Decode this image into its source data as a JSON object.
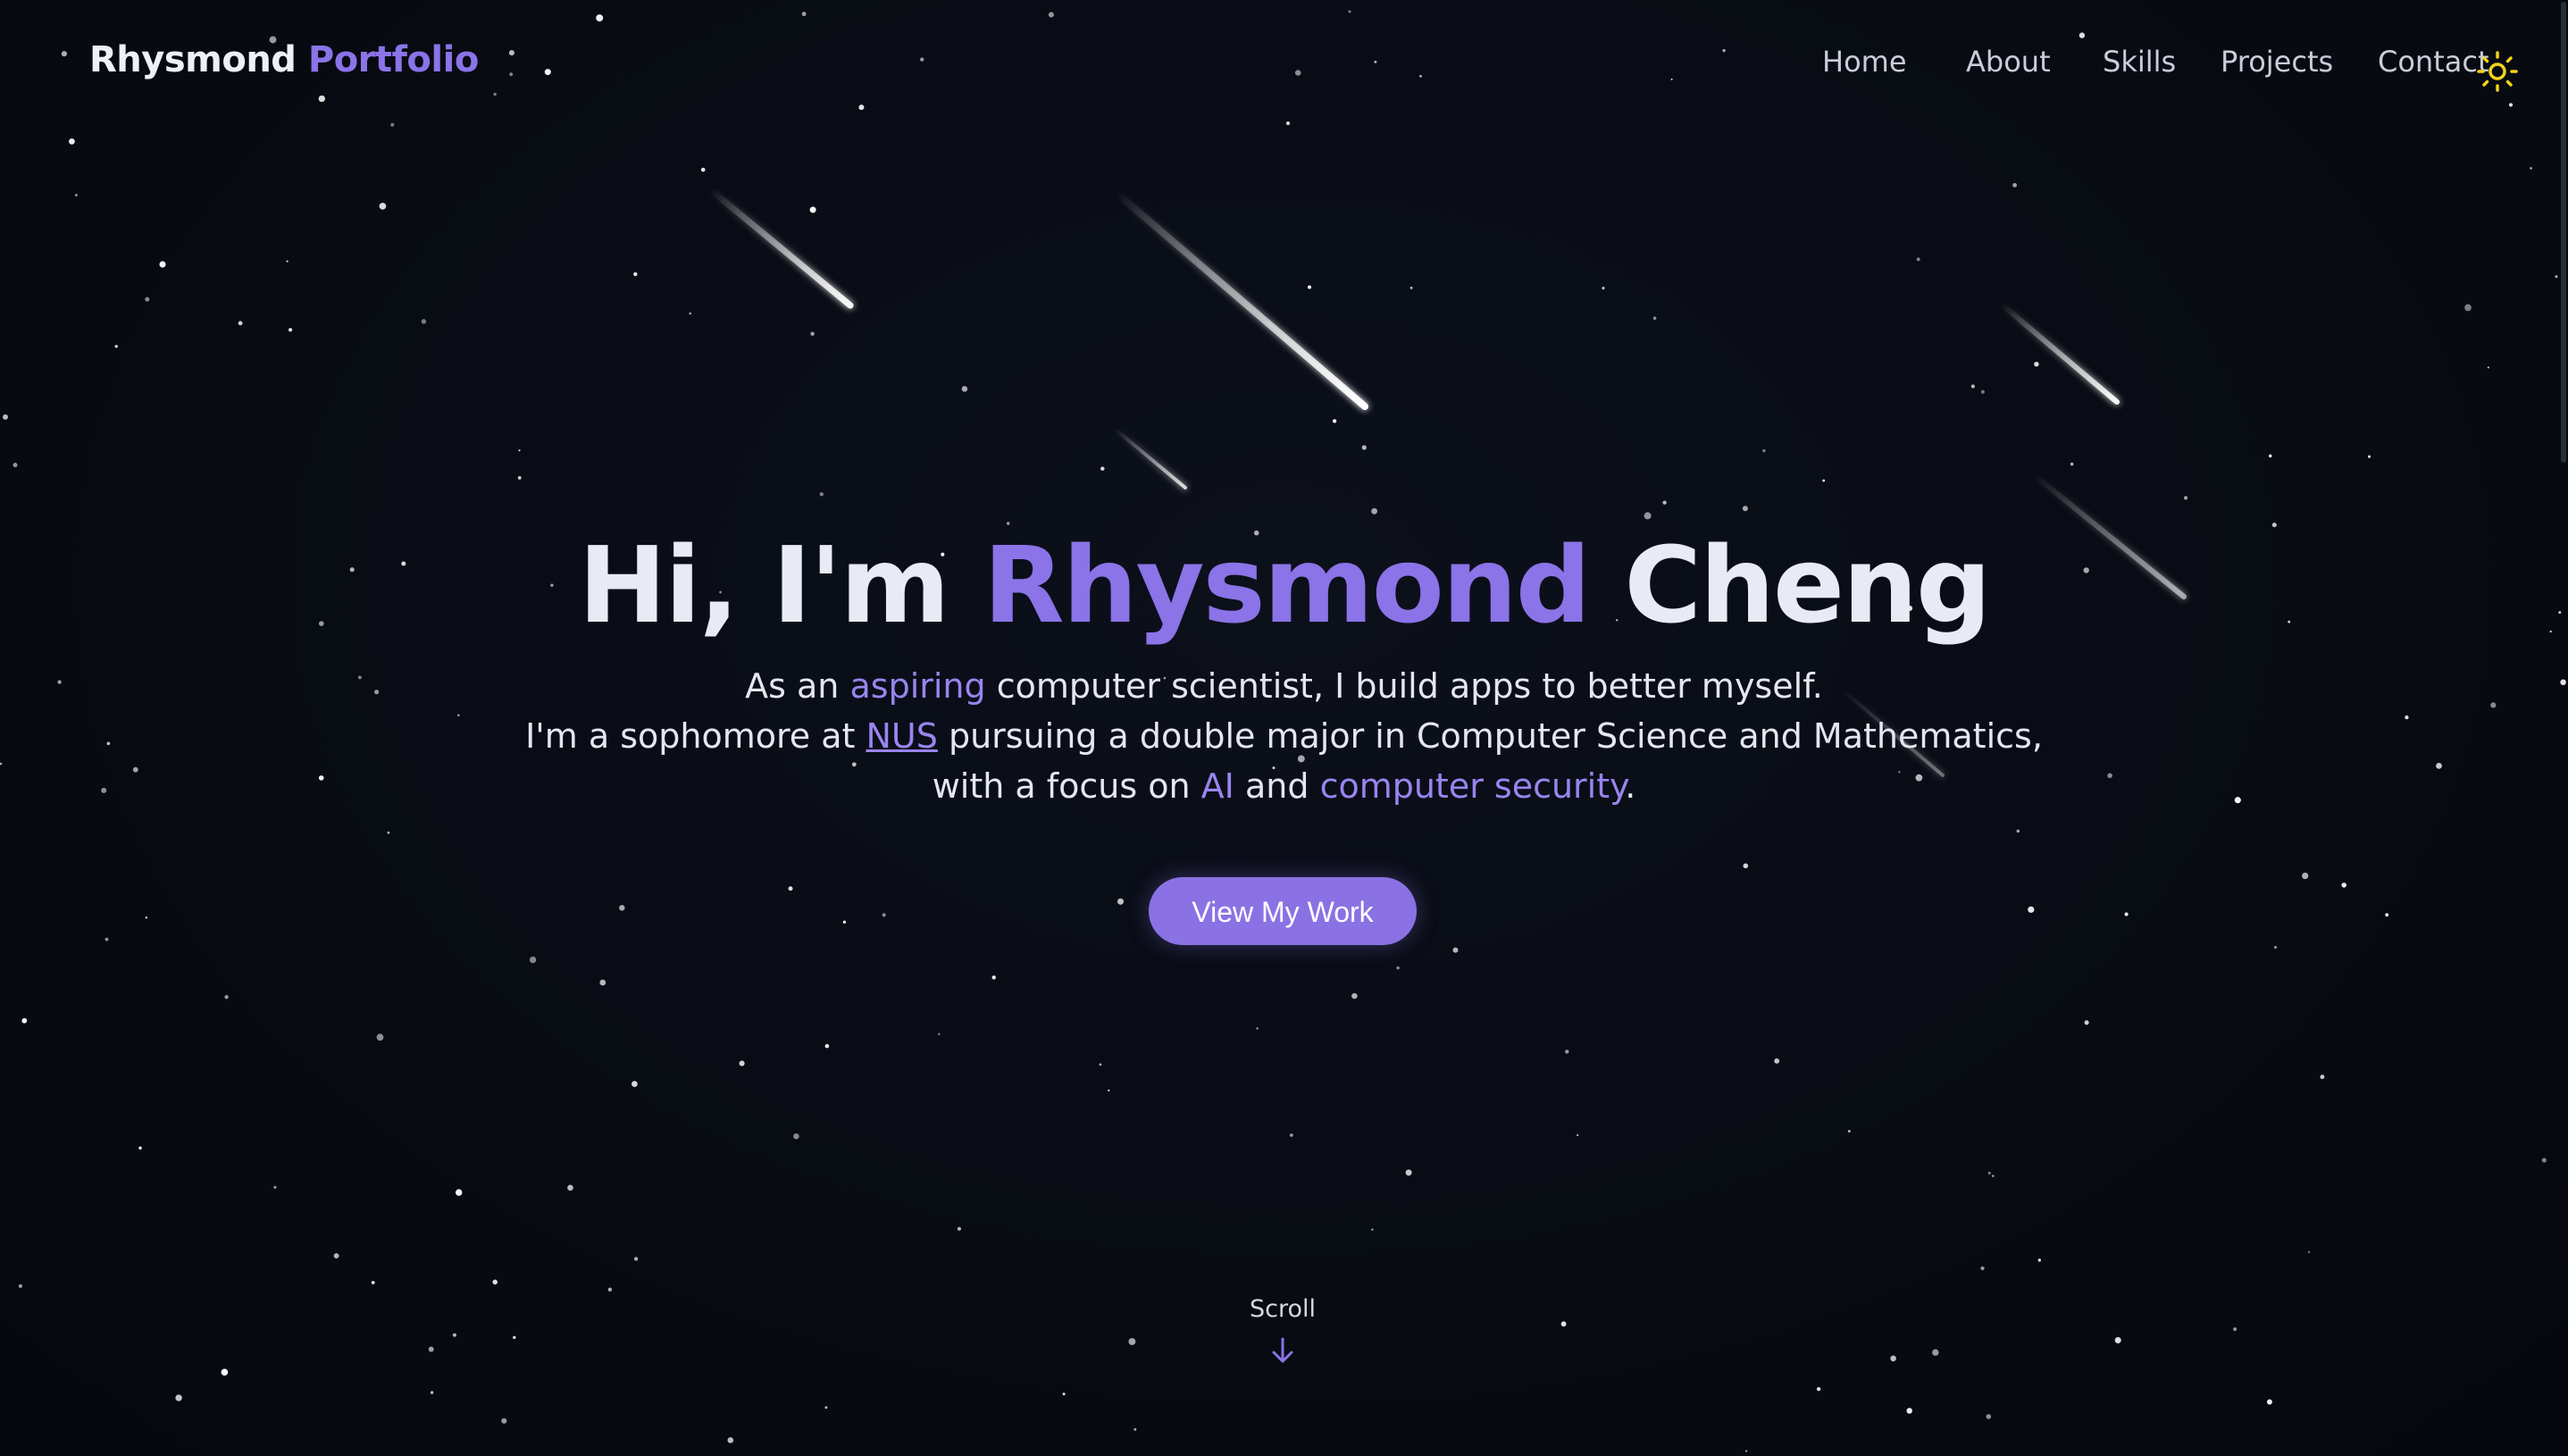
{
  "header": {
    "logo_main": "Rhysmond",
    "logo_accent": "Portfolio",
    "nav": [
      "Home",
      "About",
      "Skills",
      "Projects",
      "Contact"
    ],
    "theme_icon": "sun-icon"
  },
  "hero": {
    "title_prefix": "Hi, I'm",
    "title_first": "Rhysmond",
    "title_last": "Cheng",
    "line1_a": "As an",
    "line1_hl": "aspiring",
    "line1_b": "computer scientist, I build apps to better myself.",
    "line2_a": "I'm a sophomore at",
    "line2_link": "NUS",
    "line2_b": "pursuing a double major in Computer Science and Mathematics,",
    "line3_a": "with a focus on",
    "line3_hl1": "AI",
    "line3_mid": "and",
    "line3_hl2": "computer security",
    "line3_end": ".",
    "cta_label": "View My Work"
  },
  "scroll": {
    "label": "Scroll",
    "icon": "arrow-down-icon"
  },
  "colors": {
    "background": "#090c14",
    "accent": "#8b73e8",
    "text": "#e8ebf3",
    "sun": "#f2d21b"
  }
}
